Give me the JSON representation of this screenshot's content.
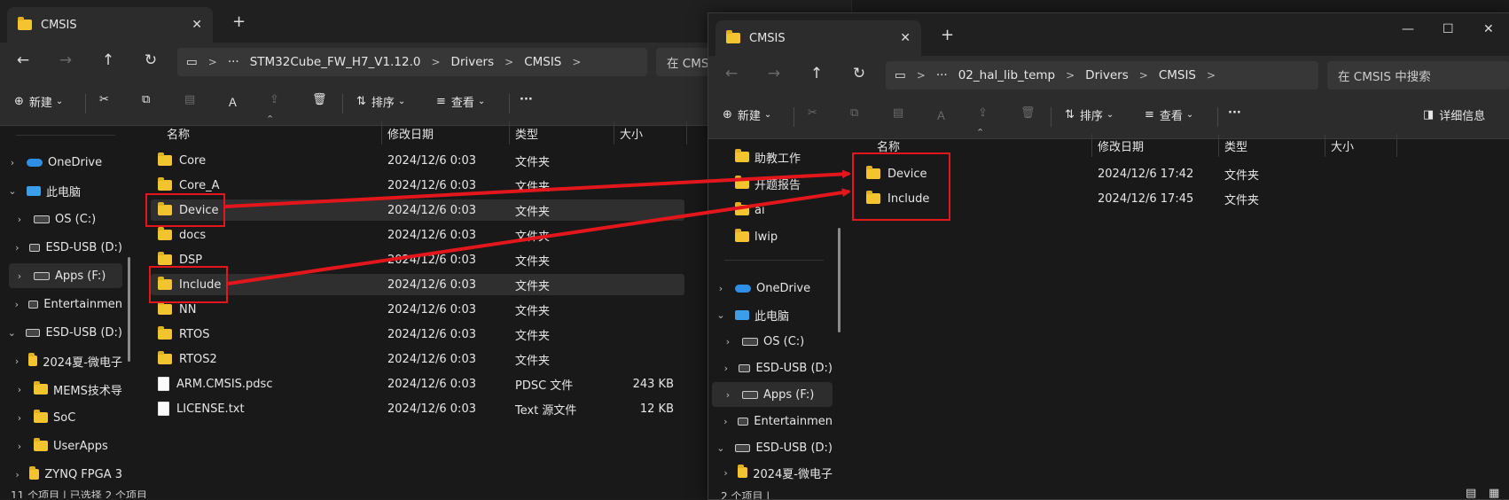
{
  "left": {
    "tab_title": "CMSIS",
    "breadcrumb": [
      "STM32Cube_FW_H7_V1.12.0",
      "Drivers",
      "CMSIS"
    ],
    "search_placeholder": "在 CMSIS",
    "toolbar": {
      "new": "新建",
      "sort": "排序",
      "view": "查看"
    },
    "nav": [
      "OneDrive",
      "此电脑",
      "OS (C:)",
      "ESD-USB (D:)",
      "Apps (F:)",
      "Entertainmen",
      "ESD-USB (D:)",
      "2024夏-微电子",
      "MEMS技术导",
      "SoC",
      "UserApps",
      "ZYNQ FPGA 3"
    ],
    "columns": [
      "名称",
      "修改日期",
      "类型",
      "大小"
    ],
    "rows": [
      {
        "name": "Core",
        "date": "2024/12/6 0:03",
        "type": "文件夹",
        "size": "",
        "icon": "folder"
      },
      {
        "name": "Core_A",
        "date": "2024/12/6 0:03",
        "type": "文件夹",
        "size": "",
        "icon": "folder"
      },
      {
        "name": "Device",
        "date": "2024/12/6 0:03",
        "type": "文件夹",
        "size": "",
        "icon": "folder"
      },
      {
        "name": "docs",
        "date": "2024/12/6 0:03",
        "type": "文件夹",
        "size": "",
        "icon": "folder"
      },
      {
        "name": "DSP",
        "date": "2024/12/6 0:03",
        "type": "文件夹",
        "size": "",
        "icon": "folder"
      },
      {
        "name": "Include",
        "date": "2024/12/6 0:03",
        "type": "文件夹",
        "size": "",
        "icon": "folder"
      },
      {
        "name": "NN",
        "date": "2024/12/6 0:03",
        "type": "文件夹",
        "size": "",
        "icon": "folder"
      },
      {
        "name": "RTOS",
        "date": "2024/12/6 0:03",
        "type": "文件夹",
        "size": "",
        "icon": "folder"
      },
      {
        "name": "RTOS2",
        "date": "2024/12/6 0:03",
        "type": "文件夹",
        "size": "",
        "icon": "folder"
      },
      {
        "name": "ARM.CMSIS.pdsc",
        "date": "2024/12/6 0:03",
        "type": "PDSC 文件",
        "size": "243 KB",
        "icon": "file"
      },
      {
        "name": "LICENSE.txt",
        "date": "2024/12/6 0:03",
        "type": "Text 源文件",
        "size": "12 KB",
        "icon": "file"
      }
    ],
    "status": "11 个项目  |  已选择 2 个项目"
  },
  "right": {
    "tab_title": "CMSIS",
    "breadcrumb": [
      "02_hal_lib_temp",
      "Drivers",
      "CMSIS"
    ],
    "search_placeholder": "在 CMSIS 中搜索",
    "toolbar": {
      "new": "新建",
      "sort": "排序",
      "view": "查看",
      "details": "详细信息"
    },
    "quick": [
      "助教工作",
      "开题报告",
      "ai",
      "lwip"
    ],
    "nav": [
      "OneDrive",
      "此电脑",
      "OS (C:)",
      "ESD-USB (D:)",
      "Apps (F:)",
      "Entertainmen",
      "ESD-USB (D:)",
      "2024夏-微电子"
    ],
    "columns": [
      "名称",
      "修改日期",
      "类型",
      "大小"
    ],
    "rows": [
      {
        "name": "Device",
        "date": "2024/12/6 17:42",
        "type": "文件夹"
      },
      {
        "name": "Include",
        "date": "2024/12/6 17:45",
        "type": "文件夹"
      }
    ],
    "status": "2 个项目  |"
  },
  "colors": {
    "highlight": "#e3171b",
    "folder": "#f4c430",
    "bg": "#191919"
  }
}
